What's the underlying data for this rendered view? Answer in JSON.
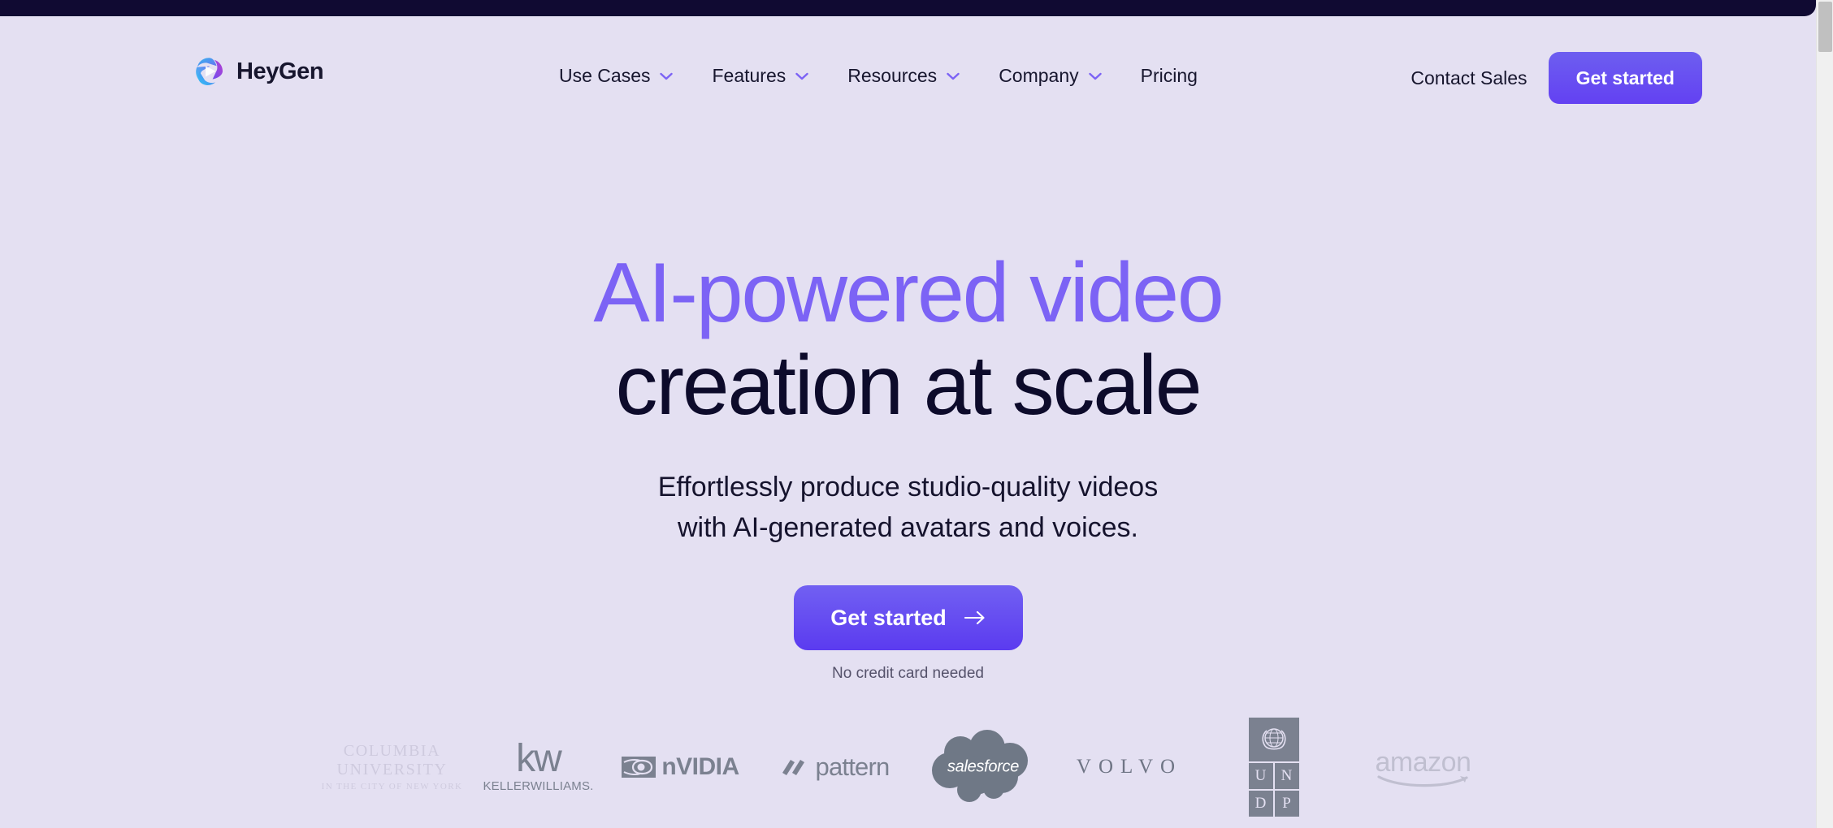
{
  "browser": {
    "scrollbar_name": "vertical-scrollbar"
  },
  "theme": {
    "page_background": "#e4e0f2",
    "topbar_color": "#100a32",
    "accent_purple": "#7c63f5",
    "cta_purple": "#6341f2",
    "heading_dark": "#0d0b2b",
    "logo_grey": "#7b8190"
  },
  "header": {
    "brand": {
      "name": "HeyGen",
      "logo_icon": "heygen-swirl-play-icon"
    },
    "nav_items": [
      {
        "label": "Use Cases",
        "has_dropdown": true,
        "icon": "chevron-down-icon"
      },
      {
        "label": "Features",
        "has_dropdown": true,
        "icon": "chevron-down-icon"
      },
      {
        "label": "Resources",
        "has_dropdown": true,
        "icon": "chevron-down-icon"
      },
      {
        "label": "Company",
        "has_dropdown": true,
        "icon": "chevron-down-icon"
      },
      {
        "label": "Pricing",
        "has_dropdown": false,
        "icon": ""
      }
    ],
    "contact_sales_label": "Contact Sales",
    "cta_label": "Get started"
  },
  "hero": {
    "title_line1": "AI-powered video",
    "title_line2": "creation at scale",
    "subtitle_line1": "Effortlessly produce studio-quality videos",
    "subtitle_line2": "with AI-generated avatars and voices.",
    "cta_label": "Get started",
    "cta_icon": "arrow-right-icon",
    "note": "No credit card needed"
  },
  "logo_strip": {
    "logos": [
      {
        "name": "Columbia University",
        "line1": "COLUMBIA UNIVERSITY",
        "line2": "IN THE CITY OF NEW YORK"
      },
      {
        "name": "Keller Williams",
        "line1": "kw",
        "line2": "KELLERWILLIAMS."
      },
      {
        "name": "NVIDIA",
        "line1": "nVIDIA",
        "line2": ""
      },
      {
        "name": "Pattern",
        "line1": "pattern",
        "line2": ""
      },
      {
        "name": "Salesforce",
        "line1": "salesforce",
        "line2": ""
      },
      {
        "name": "Volvo",
        "line1": "VOLVO",
        "line2": ""
      },
      {
        "name": "UNDP",
        "line1": "UN",
        "line2": "DP"
      },
      {
        "name": "Amazon",
        "line1": "amazon",
        "line2": ""
      }
    ]
  }
}
